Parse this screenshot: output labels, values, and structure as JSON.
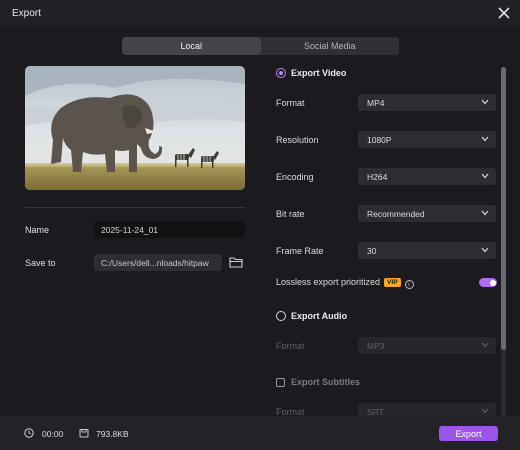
{
  "window": {
    "title": "Export"
  },
  "tabs": [
    {
      "label": "Local",
      "active": true
    },
    {
      "label": "Social Media",
      "active": false
    }
  ],
  "file": {
    "name_label": "Name",
    "name_value": "2025-11-24_01",
    "save_label": "Save to",
    "save_value": "C:/Users/dell...nloads/hitpaw"
  },
  "video": {
    "header": "Export Video",
    "format_label": "Format",
    "format_value": "MP4",
    "resolution_label": "Resolution",
    "resolution_value": "1080P",
    "encoding_label": "Encoding",
    "encoding_value": "H264",
    "bitrate_label": "Bit rate",
    "bitrate_value": "Recommended",
    "framerate_label": "Frame Rate",
    "framerate_value": "30",
    "lossless_label": "Lossless export prioritized",
    "vip_badge": "VIP",
    "lossless_on": true
  },
  "audio": {
    "header": "Export Audio",
    "format_label": "Format",
    "format_value": "MP3"
  },
  "subtitles": {
    "header": "Export Subtitles",
    "format_label": "Format",
    "format_value": "SRT"
  },
  "footer": {
    "duration": "00:00",
    "size": "793.8KB",
    "export_label": "Export"
  },
  "colors": {
    "accent": "#9b55e8",
    "vip": "#f6a623",
    "background": "#1b1b1f"
  },
  "icons": [
    "close-icon",
    "folder-icon",
    "chevron-down-icon",
    "info-icon",
    "clock-icon",
    "disk-icon"
  ]
}
